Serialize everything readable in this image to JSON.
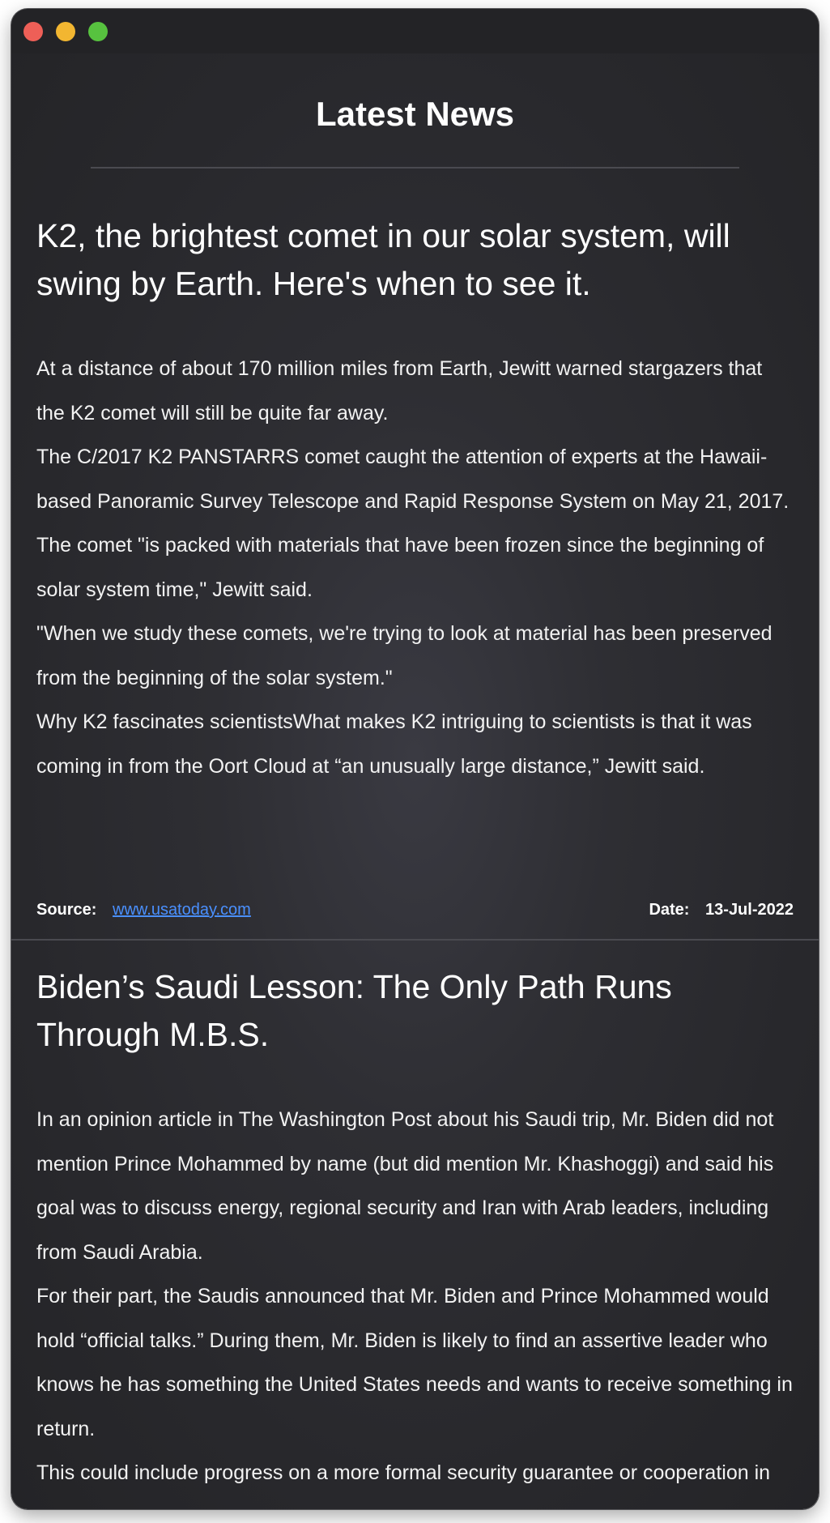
{
  "page_title": "Latest News",
  "articles": [
    {
      "headline": "K2, the brightest comet in our solar system, will swing by Earth. Here's when to see it.",
      "paragraphs": [
        "At a distance of about 170 million miles from Earth, Jewitt warned stargazers that the K2 comet will still be quite far away.",
        "The C/2017 K2 PANSTARRS comet caught the attention of experts at the Hawaii-based Panoramic Survey Telescope and Rapid Response System on May 21, 2017.",
        "The comet \"is packed with materials that have been frozen since the beginning of solar system time,\" Jewitt said.",
        "\"When we study these comets, we're trying to look at material has been preserved from the beginning of the solar system.\"",
        "Why K2 fascinates scientistsWhat makes K2 intriguing to scientists is that it was coming in from the Oort Cloud at “an unusually large distance,” Jewitt said."
      ],
      "source_label": "Source:",
      "source_link": "www.usatoday.com",
      "date_label": "Date:",
      "date_value": "13-Jul-2022"
    },
    {
      "headline": "Biden’s Saudi Lesson: The Only Path Runs Through M.B.S.",
      "paragraphs": [
        "In an opinion article in The Washington Post about his Saudi trip, Mr. Biden did not mention Prince Mohammed by name (but did mention Mr. Khashoggi) and said his goal was to discuss energy, regional security and Iran with Arab leaders, including from Saudi Arabia.",
        "For their part, the Saudis announced that Mr. Biden and Prince Mohammed would hold “official talks.” During them, Mr. Biden is likely to find an assertive leader who knows he has something the United States needs and wants to receive something in return.",
        "This could include progress on a more formal security guarantee or cooperation in realms beyond oil, said Yasmine Farouk, a nonresident scholar"
      ]
    }
  ]
}
